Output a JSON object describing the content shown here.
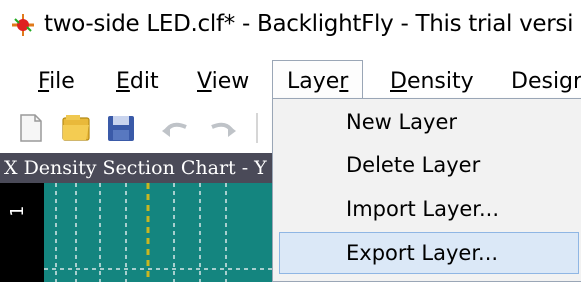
{
  "window": {
    "title": "two-side LED.clf* - BacklightFly - This trial versi"
  },
  "menubar": {
    "items": [
      {
        "label": "File",
        "accel": "F",
        "rest": "ile"
      },
      {
        "label": "Edit",
        "accel": "E",
        "rest": "dit"
      },
      {
        "label": "View",
        "accel": "V",
        "rest": "iew"
      },
      {
        "label": "Layer",
        "pre": "Laye",
        "accel": "r"
      },
      {
        "label": "Density",
        "accel": "D",
        "rest": "ensity"
      },
      {
        "label": "Desigr",
        "pre": "Desigr"
      }
    ]
  },
  "chart": {
    "title": "X Density Section Chart - Y",
    "y_tick": "1"
  },
  "layer_menu": {
    "items": [
      "New Layer",
      "Delete Layer",
      "Import Layer...",
      "Export Layer..."
    ],
    "hovered_index": 3
  },
  "colors": {
    "chart_bg": "#14857f",
    "hover_bg": "#dbe8f7",
    "hover_border": "#8fb6e4"
  }
}
